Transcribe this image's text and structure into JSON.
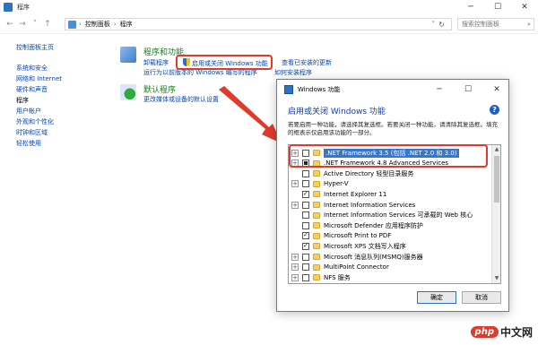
{
  "window": {
    "title": "程序"
  },
  "address": {
    "parts": [
      "控制面板",
      "程序"
    ],
    "search_placeholder": "搜索控制面板"
  },
  "sidebar": {
    "home": "控制面板主页",
    "items": [
      {
        "label": "系统和安全"
      },
      {
        "label": "网络和 Internet"
      },
      {
        "label": "硬件和声音"
      },
      {
        "label": "程序"
      },
      {
        "label": "用户帐户"
      },
      {
        "label": "外观和个性化"
      },
      {
        "label": "时钟和区域"
      },
      {
        "label": "轻松使用"
      }
    ]
  },
  "programs_section": {
    "title": "程序和功能",
    "links": {
      "uninstall": "卸载程序",
      "toggle_features": "启用或关闭 Windows 功能",
      "view_updates": "查看已安装的更新",
      "run_old": "运行为以前版本的 Windows 编写的程序",
      "how_install": "如何安装程序"
    }
  },
  "default_section": {
    "title": "默认程序",
    "link": "更改媒体或设备的默认设置"
  },
  "dialog": {
    "title": "Windows 功能",
    "heading": "启用或关闭 Windows 功能",
    "help": "?",
    "description": "若要启用一种功能，请选择其复选框。若要关闭一种功能，请清除其复选框。填充的框表示仅启用该功能的一部分。",
    "features": [
      {
        "label": ".NET Framework 3.5 (包括 .NET 2.0 和 3.0)",
        "state": "unchecked",
        "expandable": true,
        "selected": true
      },
      {
        "label": ".NET Framework 4.8 Advanced Services",
        "state": "partial",
        "expandable": true,
        "selected": false
      },
      {
        "label": "Active Directory 轻型目录服务",
        "state": "unchecked",
        "expandable": false,
        "selected": false
      },
      {
        "label": "Hyper-V",
        "state": "unchecked",
        "expandable": true,
        "selected": false
      },
      {
        "label": "Internet Explorer 11",
        "state": "checked",
        "expandable": false,
        "selected": false
      },
      {
        "label": "Internet Information Services",
        "state": "unchecked",
        "expandable": true,
        "selected": false
      },
      {
        "label": "Internet Information Services 可承载的 Web 核心",
        "state": "unchecked",
        "expandable": false,
        "selected": false
      },
      {
        "label": "Microsoft Defender 应用程序防护",
        "state": "unchecked",
        "expandable": false,
        "selected": false
      },
      {
        "label": "Microsoft Print to PDF",
        "state": "checked",
        "expandable": false,
        "selected": false
      },
      {
        "label": "Microsoft XPS 文档写入程序",
        "state": "checked",
        "expandable": false,
        "selected": false
      },
      {
        "label": "Microsoft 消息队列(MSMQ)服务器",
        "state": "unchecked",
        "expandable": true,
        "selected": false
      },
      {
        "label": "MultiPoint Connector",
        "state": "unchecked",
        "expandable": true,
        "selected": false
      },
      {
        "label": "NFS 服务",
        "state": "unchecked",
        "expandable": true,
        "selected": false
      }
    ],
    "ok": "确定",
    "cancel": "取消"
  },
  "watermark": {
    "php": "php",
    "cn": "中文网"
  },
  "colors": {
    "highlight": "#e03a2b",
    "link": "#0645ad",
    "selection": "#3576d0"
  }
}
